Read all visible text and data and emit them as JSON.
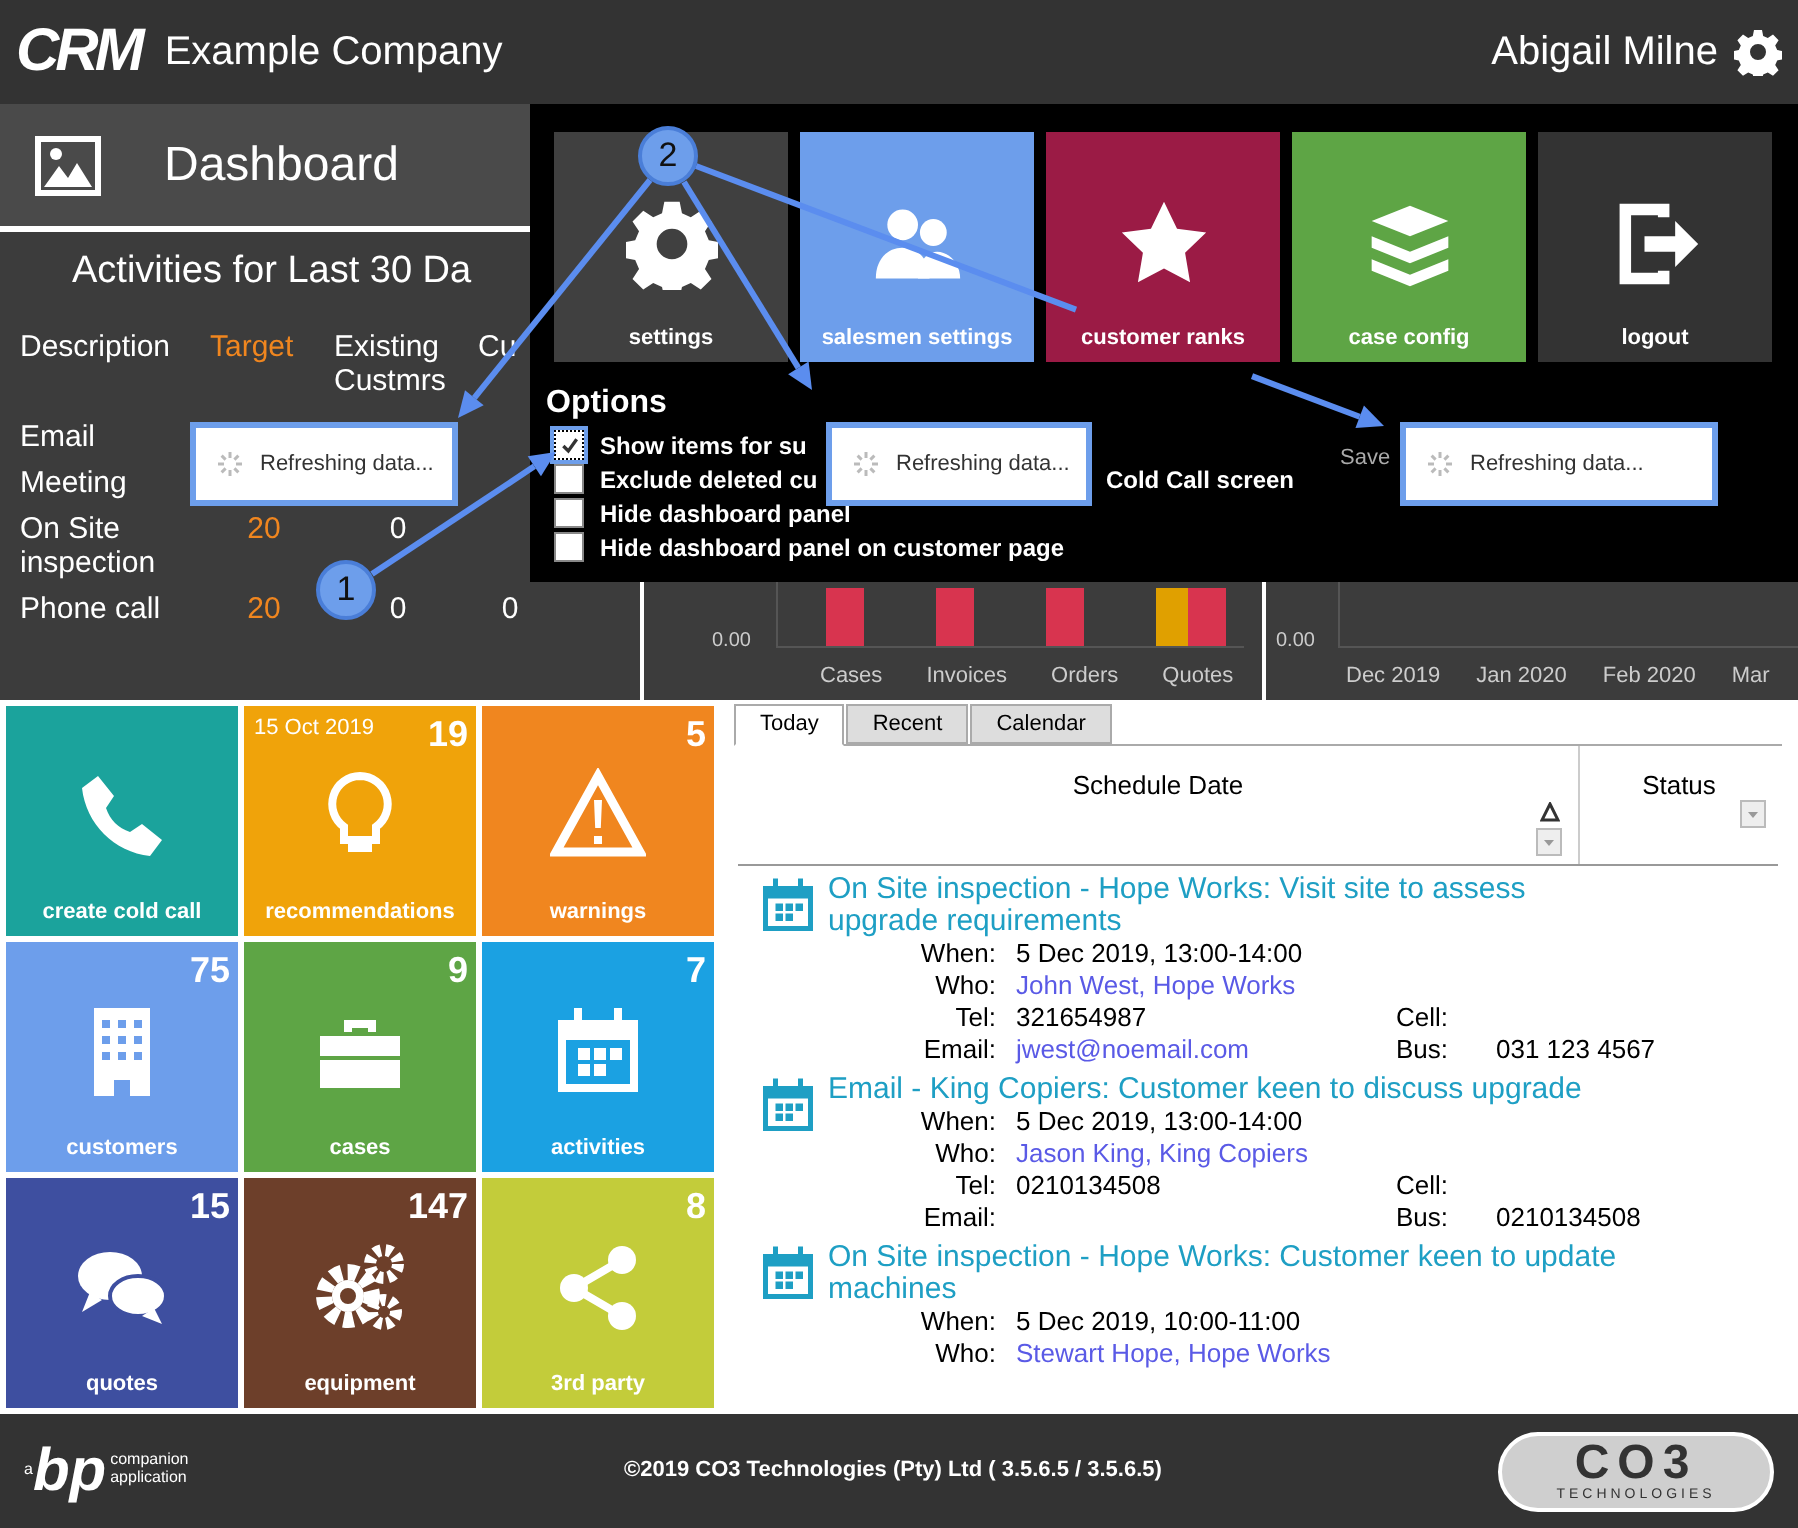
{
  "header": {
    "logo": "CRM",
    "company": "Example Company",
    "user": "Abigail Milne"
  },
  "dashboard": {
    "title": "Dashboard",
    "activities": {
      "title": "Activities for Last 30 Da",
      "columns": [
        "Description",
        "Target",
        "Existing Custmrs",
        "Cu"
      ],
      "rows": [
        {
          "description": "Email"
        },
        {
          "description": "Meeting"
        },
        {
          "description": "On Site inspection",
          "target": "20",
          "existing": "0"
        },
        {
          "description": "Phone call",
          "target": "20",
          "existing": "0",
          "column_4": "0"
        }
      ]
    }
  },
  "charts": [
    {
      "y_tick": "0.00",
      "categories": [
        "Cases",
        "Invoices",
        "Orders",
        "Quotes"
      ]
    },
    {
      "y_tick": "0.00",
      "categories": [
        "Dec 2019",
        "Jan 2020",
        "Feb 2020",
        "Mar"
      ]
    }
  ],
  "menu": {
    "tiles": [
      {
        "label": "settings",
        "kind": "gear",
        "color": "#404040"
      },
      {
        "label": "salesmen settings",
        "kind": "people",
        "color": "#6d9eeb"
      },
      {
        "label": "customer ranks",
        "kind": "star",
        "color": "#9b1b45"
      },
      {
        "label": "case config",
        "kind": "layers",
        "color": "#5ea545"
      },
      {
        "label": "logout",
        "kind": "logout",
        "color": "#333333"
      }
    ],
    "options": {
      "title": "Options",
      "items": [
        {
          "label": "Show items for su",
          "checked": true,
          "focused": true
        },
        {
          "label": "Exclude deleted cu",
          "trailing": "Cold Call screen",
          "checked": false,
          "focused": false
        },
        {
          "label": "Hide dashboard panel",
          "checked": false,
          "focused": false
        },
        {
          "label": "Hide dashboard panel on customer page",
          "checked": false,
          "focused": false
        }
      ]
    },
    "save": "Save"
  },
  "popups": [
    {
      "text": "Refreshing data..."
    },
    {
      "text": "Refreshing data..."
    },
    {
      "text": "Refreshing data..."
    }
  ],
  "callouts": [
    {
      "number": "1"
    },
    {
      "number": "2"
    }
  ],
  "tiles": [
    {
      "label": "create cold call",
      "kind": "phone",
      "color": "#1ba39c"
    },
    {
      "label": "recommendations",
      "kind": "bulb",
      "color": "#f0a30a",
      "count": "19",
      "date": "15 Oct 2019"
    },
    {
      "label": "warnings",
      "kind": "warning",
      "color": "#f0861f",
      "count": "5"
    },
    {
      "label": "customers",
      "kind": "building",
      "color": "#6d9eeb",
      "count": "75"
    },
    {
      "label": "cases",
      "kind": "briefcase",
      "color": "#5ea545",
      "count": "9"
    },
    {
      "label": "activities",
      "kind": "calendar",
      "color": "#1ba1e2",
      "count": "7"
    },
    {
      "label": "quotes",
      "kind": "chat",
      "color": "#3e4fa0",
      "count": "15"
    },
    {
      "label": "equipment",
      "kind": "gears",
      "color": "#6d3f2a",
      "count": "147"
    },
    {
      "label": "3rd party",
      "kind": "share",
      "color": "#c3cc3a",
      "count": "8"
    }
  ],
  "schedule": {
    "tabs": [
      {
        "label": "Today",
        "selected": true
      },
      {
        "label": "Recent",
        "selected": false
      },
      {
        "label": "Calendar",
        "selected": false
      }
    ],
    "columns": [
      "Schedule Date",
      "Status"
    ],
    "entries": [
      {
        "title": "On Site inspection - Hope Works: Visit site to assess upgrade requirements",
        "rows": [
          {
            "label": "When:",
            "value": "5 Dec 2019, 13:00-14:00",
            "link": false
          },
          {
            "label": "Who:",
            "value": "John West, Hope Works",
            "link": true
          },
          {
            "label": "Tel:",
            "value": "321654987",
            "link": false,
            "label_2": "Cell:"
          },
          {
            "label": "Email:",
            "value": "jwest@noemail.com",
            "link": true,
            "label_2": "Bus:",
            "value_2": "031 123 4567"
          }
        ]
      },
      {
        "title": "Email - King Copiers: Customer keen to discuss upgrade",
        "rows": [
          {
            "label": "When:",
            "value": "5 Dec 2019, 13:00-14:00",
            "link": false
          },
          {
            "label": "Who:",
            "value": "Jason King, King Copiers",
            "link": true
          },
          {
            "label": "Tel:",
            "value": "0210134508",
            "link": false,
            "label_2": "Cell:"
          },
          {
            "label": "Email:",
            "label_2": "Bus:",
            "value_2": "0210134508"
          }
        ]
      },
      {
        "title": "On Site inspection - Hope Works: Customer keen to update machines",
        "rows": [
          {
            "label": "When:",
            "value": "5 Dec 2019, 10:00-11:00",
            "link": false
          },
          {
            "label": "Who:",
            "value": "Stewart Hope, Hope Works",
            "link": true
          }
        ]
      }
    ]
  },
  "footer": {
    "logo_prefix": "a",
    "logo_letters": "bp",
    "logo_caption": "companion application",
    "copyright": "©2019 CO3 Technologies (Pty) Ltd ( 3.5.6.5 / 3.5.6.5)",
    "brand": "CO3",
    "brand_caption": "TECHNOLOGIES"
  }
}
